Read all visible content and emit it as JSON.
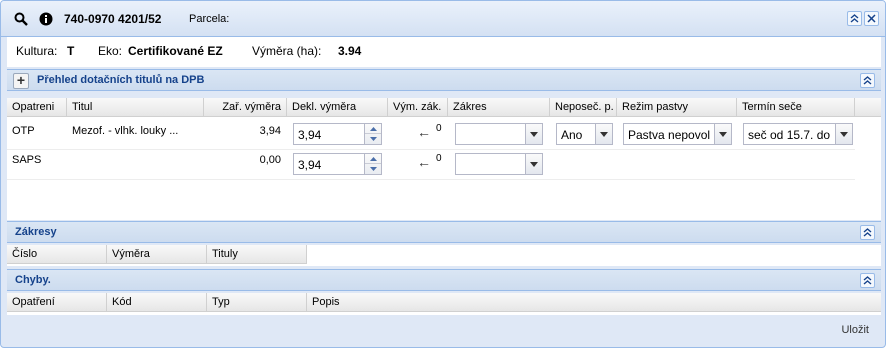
{
  "titlebar": {
    "parcel_code": "740-0970 4201/52",
    "parcela_label": "Parcela:"
  },
  "info": {
    "kultura_label": "Kultura:",
    "kultura_value": "T",
    "eko_label": "Eko:",
    "eko_value": "Certifikované EZ",
    "vymera_label": "Výměra (ha):",
    "vymera_value": "3.94"
  },
  "dpb_panel": {
    "title": "Přehled dotačních titulů na DPB",
    "columns": [
      "Opatreni",
      "Titul",
      "Zař. výměra",
      "Dekl. výměra",
      "Vým. zák.",
      "Zákres",
      "Neposeč. p.",
      "Režim pastvy",
      "Termín seče"
    ],
    "rows": [
      {
        "opatreni": "OTP",
        "titul": "Mezof. - vlhk. louky ...",
        "zar_vymera": "3,94",
        "dekl_vymera": "3,94",
        "vym_zak": "0",
        "zakres": "",
        "neposec": "Ano",
        "rezim_pastvy": "Pastva nepovol",
        "termin_sece": "seč od 15.7. do"
      },
      {
        "opatreni": "SAPS",
        "titul": "",
        "zar_vymera": "0,00",
        "dekl_vymera": "3,94",
        "vym_zak": "0",
        "zakres": ""
      }
    ]
  },
  "zakresy_panel": {
    "title": "Zákresy",
    "columns": [
      "Číslo",
      "Výměra",
      "Tituly"
    ]
  },
  "chyby_panel": {
    "title": "Chyby.",
    "columns": [
      "Opatření",
      "Kód",
      "Typ",
      "Popis"
    ]
  },
  "footer": {
    "save_label": "Uložit"
  }
}
